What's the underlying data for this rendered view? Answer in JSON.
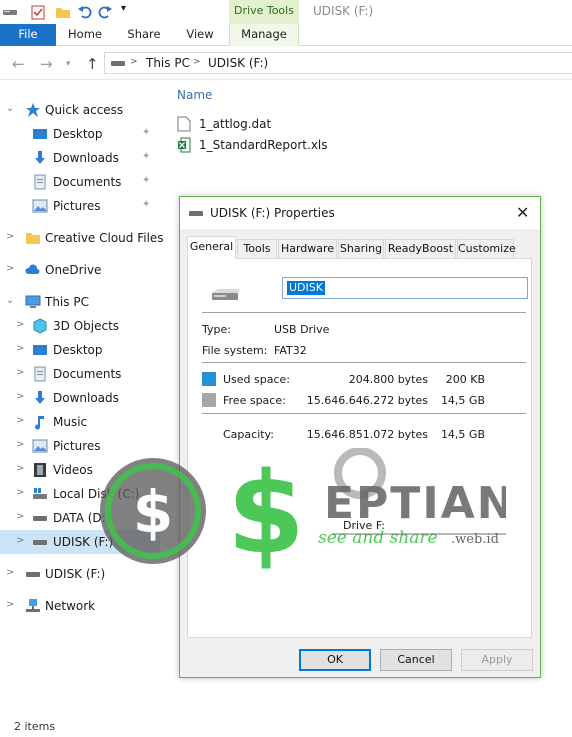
{
  "ribbon": {
    "contextual_label": "Drive Tools",
    "window_title": "UDISK (F:)",
    "tabs": [
      "File",
      "Home",
      "Share",
      "View",
      "Manage"
    ]
  },
  "address": {
    "crumbs": [
      "This PC",
      "UDISK (F:)"
    ]
  },
  "nav": {
    "items": [
      {
        "label": "Quick access",
        "icon": "star-icon"
      },
      {
        "label": "Desktop",
        "icon": "desktop-icon",
        "pinned": true
      },
      {
        "label": "Downloads",
        "icon": "downloads-icon",
        "pinned": true
      },
      {
        "label": "Documents",
        "icon": "documents-icon",
        "pinned": true
      },
      {
        "label": "Pictures",
        "icon": "pictures-icon",
        "pinned": true
      },
      {
        "label": "Creative Cloud Files",
        "icon": "folder-icon"
      },
      {
        "label": "OneDrive",
        "icon": "cloud-icon"
      },
      {
        "label": "This PC",
        "icon": "computer-icon"
      },
      {
        "label": "3D Objects",
        "icon": "cube-icon"
      },
      {
        "label": "Desktop",
        "icon": "desktop-icon"
      },
      {
        "label": "Documents",
        "icon": "documents-icon"
      },
      {
        "label": "Downloads",
        "icon": "downloads-icon"
      },
      {
        "label": "Music",
        "icon": "music-icon"
      },
      {
        "label": "Pictures",
        "icon": "pictures-icon"
      },
      {
        "label": "Videos",
        "icon": "videos-icon"
      },
      {
        "label": "Local Disk (C:)",
        "icon": "windows-drive-icon"
      },
      {
        "label": "DATA (D:)",
        "icon": "drive-icon"
      },
      {
        "label": "UDISK (F:)",
        "icon": "drive-icon",
        "selected": true
      },
      {
        "label": "UDISK (F:)",
        "icon": "drive-icon"
      },
      {
        "label": "Network",
        "icon": "network-icon"
      }
    ]
  },
  "files": {
    "column_name": "Name",
    "items": [
      {
        "name": "1_attlog.dat",
        "icon": "file-icon"
      },
      {
        "name": "1_StandardReport.xls",
        "icon": "excel-icon"
      }
    ]
  },
  "status": {
    "items_count": "2 items"
  },
  "dialog": {
    "title": "UDISK (F:) Properties",
    "tabs": [
      "General",
      "Tools",
      "Hardware",
      "Sharing",
      "ReadyBoost",
      "Customize"
    ],
    "volume_name": "UDISK",
    "type_label": "Type:",
    "type_value": "USB Drive",
    "fs_label": "File system:",
    "fs_value": "FAT32",
    "used_label": "Used space:",
    "used_bytes": "204.800 bytes",
    "used_human": "200 KB",
    "free_label": "Free space:",
    "free_bytes": "15.646.646.272 bytes",
    "free_human": "14,5 GB",
    "capacity_label": "Capacity:",
    "capacity_bytes": "15.646.851.072 bytes",
    "capacity_human": "14,5 GB",
    "drive_label": "Drive F:",
    "used_fraction": 1.31e-05,
    "buttons": {
      "ok": "OK",
      "cancel": "Cancel",
      "apply": "Apply"
    },
    "colors": {
      "used": "#2690d8",
      "free": "#a6a6a6"
    }
  },
  "watermark": {
    "brand": "EPTIAN",
    "tagline": "see and share",
    "domain": ".web.id",
    "colors": {
      "green": "#3ec44a",
      "gray": "#6b6b6b"
    }
  },
  "colors": {
    "accent": "#1a73c7",
    "selection": "#cce4f7",
    "dialog_border": "#6ab04c"
  }
}
